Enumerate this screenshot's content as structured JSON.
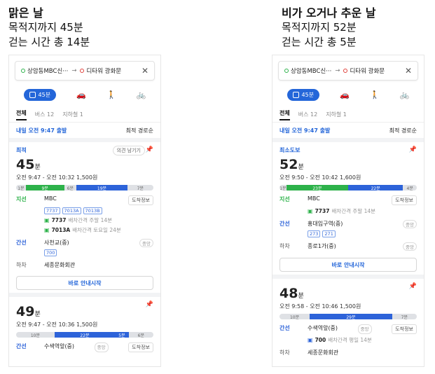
{
  "left": {
    "caption": {
      "title": "맑은 날",
      "line1": "목적지까지 45분",
      "line2": "걷는 시간 총 14분"
    },
    "search": {
      "from": "상암동MBC신···",
      "to": "디타워 광화문"
    },
    "mode_active": "45분",
    "tabs": [
      "전체",
      "버스 12",
      "지하철 1"
    ],
    "departure": "내일 오전 9:47 출발",
    "sort": "최적 경로순",
    "routes": [
      {
        "tag": "최적",
        "feedback": "의견 남기기",
        "minutes": "45",
        "unit": "분",
        "time": "오전 9:47 - 오전 10:32  1,500원",
        "segments": [
          {
            "t": "1분",
            "c": "w",
            "f": 0.07
          },
          {
            "t": "9분",
            "c": "g",
            "f": 0.28
          },
          {
            "t": "6분",
            "c": "w",
            "f": 0.09
          },
          {
            "t": "19분",
            "c": "b",
            "f": 0.37
          },
          {
            "t": "7분",
            "c": "w",
            "f": 0.19
          }
        ],
        "steps": [
          {
            "type": "지선",
            "cls": "g",
            "name": "MBC",
            "btn": "도착정보",
            "chips": [
              "7737",
              "7013A",
              "7013B"
            ],
            "sub": [
              {
                "bus": "7737",
                "info": "배차간격 주말 14분"
              },
              {
                "bus": "7013A",
                "info": "배차간격 토요일 24분"
              }
            ]
          },
          {
            "type": "간선",
            "cls": "b",
            "name": "사천교(중)",
            "badge": "중앙",
            "chips": [
              "700"
            ]
          },
          {
            "type": "하차",
            "cls": "k",
            "name": "세종문화회관"
          }
        ],
        "go": "바로 안내시작"
      },
      {
        "minutes": "49",
        "unit": "분",
        "time": "오전 9:47 - 오전 10:36  1,500원",
        "segments": [
          {
            "t": "10분",
            "c": "w",
            "f": 0.28
          },
          {
            "t": "22분",
            "c": "b",
            "f": 0.44
          },
          {
            "t": "5분",
            "c": "b",
            "f": 0.1
          },
          {
            "t": "6분",
            "c": "w",
            "f": 0.18
          }
        ],
        "steps": [
          {
            "type": "간선",
            "cls": "b",
            "name": "수색역앞(중)",
            "badge": "중앙",
            "btn": "도착정보"
          }
        ]
      }
    ]
  },
  "right": {
    "caption": {
      "title": "비가 오거나 추운 날",
      "line1": "목적지까지 52분",
      "line2": "걷는 시간 총 5분"
    },
    "search": {
      "from": "상암동MBC신···",
      "to": "디타워 광화문"
    },
    "mode_active": "45분",
    "tabs": [
      "전체",
      "버스 12",
      "지하철 1"
    ],
    "departure": "내일 오전 9:47 출발",
    "sort": "최적 경로순",
    "routes": [
      {
        "tag": "최소도보",
        "minutes": "52",
        "unit": "분",
        "time": "오전 9:50 - 오전 10:42  1,600원",
        "segments": [
          {
            "t": "1분",
            "c": "w",
            "f": 0.05
          },
          {
            "t": "23분",
            "c": "g",
            "f": 0.45
          },
          {
            "t": "22분",
            "c": "b",
            "f": 0.4
          },
          {
            "t": "4분",
            "c": "w",
            "f": 0.1
          }
        ],
        "steps": [
          {
            "type": "지선",
            "cls": "g",
            "name": "MBC",
            "btn": "도착정보",
            "sub": [
              {
                "bus": "7737",
                "info": "배차간격 주말 14분"
              }
            ]
          },
          {
            "type": "간선",
            "cls": "b",
            "name": "홍대입구역(중)",
            "badge": "중앙",
            "chips": [
              "273",
              "271"
            ]
          },
          {
            "type": "하차",
            "cls": "k",
            "name": "종로1가(중)",
            "badge": "중앙"
          }
        ],
        "go": "바로 안내시작"
      },
      {
        "minutes": "48",
        "unit": "분",
        "time": "오전 9:58 - 오전 10:46  1,500원",
        "segments": [
          {
            "t": "10분",
            "c": "w",
            "f": 0.22
          },
          {
            "t": "29분",
            "c": "b",
            "f": 0.6
          },
          {
            "t": "7분",
            "c": "w",
            "f": 0.18
          }
        ],
        "steps": [
          {
            "type": "간선",
            "cls": "b",
            "name": "수색역앞(중)",
            "badge": "중앙",
            "btn": "도착정보",
            "sub": [
              {
                "bus": "700",
                "info": "배차간격 평일 14분",
                "blue": true
              }
            ]
          },
          {
            "type": "하차",
            "cls": "k",
            "name": "세종문화회관"
          }
        ]
      }
    ]
  }
}
